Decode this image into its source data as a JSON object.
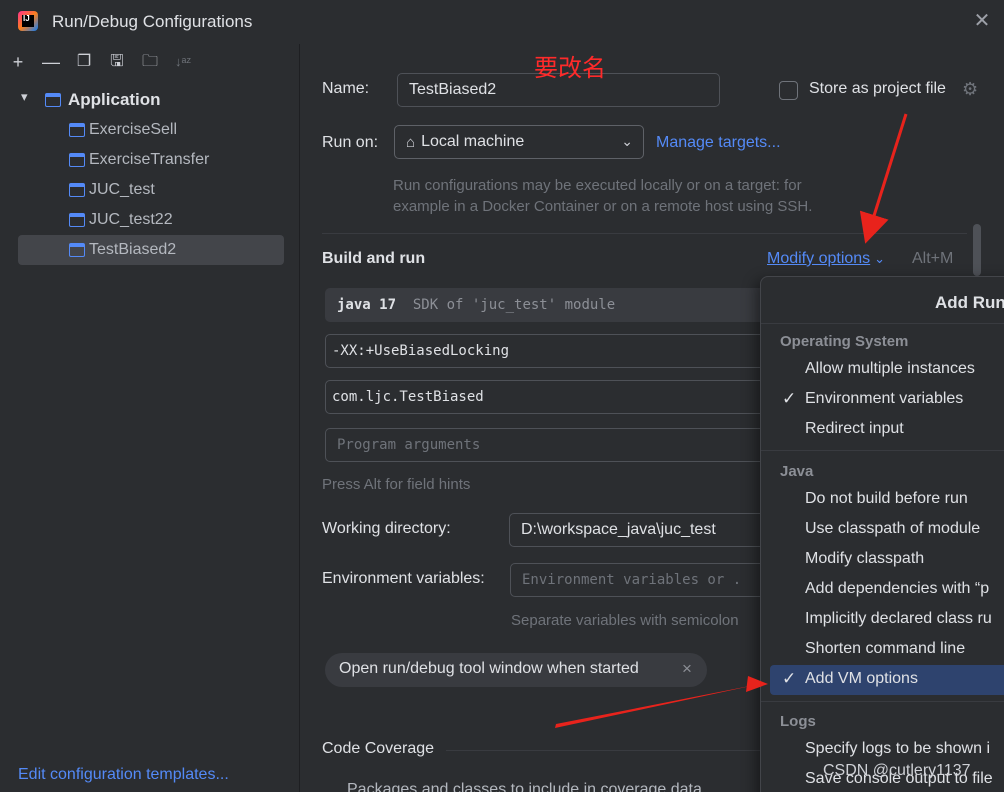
{
  "window": {
    "title": "Run/Debug Configurations",
    "close_glyph": "✕"
  },
  "toolbar": {
    "add": "+",
    "remove": "—",
    "copy": "❐",
    "save": "🖫",
    "folder": "🗀",
    "sort": "↓ᵃᶻ"
  },
  "tree": {
    "group_label": "Application",
    "items": [
      {
        "label": "ExerciseSell"
      },
      {
        "label": "ExerciseTransfer"
      },
      {
        "label": "JUC_test"
      },
      {
        "label": "JUC_test22"
      },
      {
        "label": "TestBiased2",
        "selected": true
      }
    ],
    "edit_templates": "Edit configuration templates..."
  },
  "form": {
    "name_label": "Name:",
    "name_value": "TestBiased2",
    "store_label": "Store as project file",
    "run_on_label": "Run on:",
    "run_on_value": "Local machine",
    "manage_targets": "Manage targets...",
    "run_hint_1": "Run configurations may be executed locally or on a target: for",
    "run_hint_2": "example in a Docker Container or on a remote host using SSH.",
    "build_title": "Build and run",
    "modify_options": "Modify options",
    "modify_shortcut": "Alt+M",
    "sdk_main": "java 17",
    "sdk_sub": "SDK of 'juc_test' module",
    "vm_options": "-XX:+UseBiasedLocking",
    "main_class": "com.ljc.TestBiased",
    "program_args_placeholder": "Program arguments",
    "alt_hint": "Press Alt for field hints",
    "workdir_label": "Working directory:",
    "workdir_value": "D:\\workspace_java\\juc_test",
    "env_label": "Environment variables:",
    "env_placeholder": "Environment variables or .",
    "env_hint": "Separate variables with semicolon",
    "chip_label": "Open run/debug tool window when started",
    "chip_close": "×",
    "coverage_title": "Code Coverage",
    "coverage_sub": "Packages and classes to include in coverage data"
  },
  "menu": {
    "title": "Add Run",
    "sections": [
      {
        "title": "Operating System",
        "items": [
          {
            "label": "Allow multiple instances",
            "checked": false
          },
          {
            "label": "Environment variables",
            "checked": true
          },
          {
            "label": "Redirect input",
            "checked": false
          }
        ]
      },
      {
        "title": "Java",
        "items": [
          {
            "label": "Do not build before run",
            "checked": false
          },
          {
            "label": "Use classpath of module",
            "checked": false
          },
          {
            "label": "Modify classpath",
            "checked": false
          },
          {
            "label": "Add dependencies with “p",
            "checked": false
          },
          {
            "label": "Implicitly declared class ru",
            "checked": false
          },
          {
            "label": "Shorten command line",
            "checked": false
          },
          {
            "label": "Add VM options",
            "checked": true,
            "highlighted": true
          }
        ]
      },
      {
        "title": "Logs",
        "items": [
          {
            "label": "Specify logs to be shown i",
            "checked": false
          },
          {
            "label": "Save console output to file",
            "checked": false
          }
        ]
      }
    ],
    "check_glyph": "✓"
  },
  "annotation": {
    "text": "要改名",
    "color": "#ff2a2a"
  },
  "watermark": "CSDN @cutlery1137",
  "colors": {
    "background": "#2b2d30",
    "link": "#548af7",
    "highlight": "#2e436e",
    "arrow": "#e8231c"
  }
}
